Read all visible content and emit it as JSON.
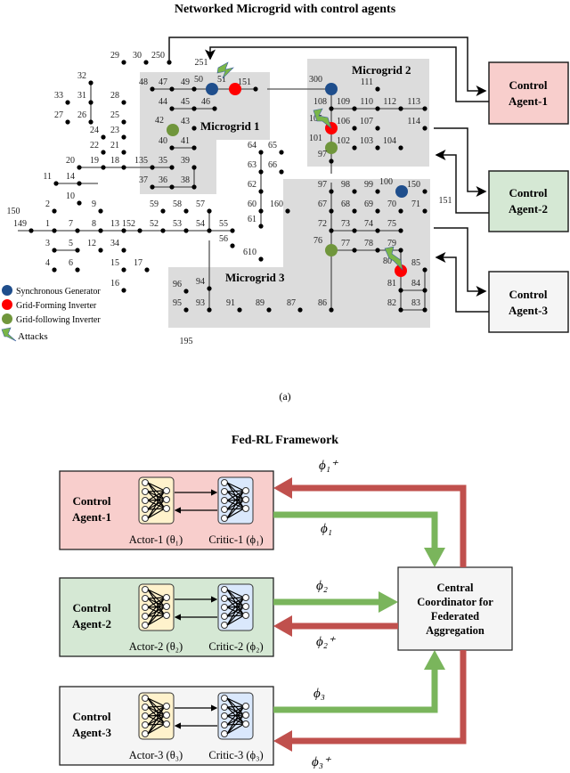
{
  "top_title": "Networked Microgrid with control agents",
  "caption": "(a)",
  "microgrids": [
    "Microgrid 1",
    "Microgrid 2",
    "Microgrid 3"
  ],
  "agents_top": [
    "Control Agent-1",
    "Control Agent-2",
    "Control Agent-3"
  ],
  "legend": [
    {
      "label": "Synchronous Generator",
      "color": "#1f4e8c"
    },
    {
      "label": "Grid-Forming Inverter",
      "color": "#ff0000"
    },
    {
      "label": "Grid-following Inverter",
      "color": "#70963c"
    },
    {
      "label": "Attacks",
      "color": "#7ab648"
    }
  ],
  "nodes": [
    "29",
    "30",
    "250",
    "251",
    "48",
    "47",
    "49",
    "50",
    "51",
    "151",
    "44",
    "45",
    "46",
    "42",
    "43",
    "40",
    "41",
    "135",
    "35",
    "39",
    "37",
    "36",
    "38",
    "32",
    "33",
    "31",
    "28",
    "27",
    "26",
    "25",
    "24",
    "23",
    "22",
    "21",
    "20",
    "19",
    "18",
    "11",
    "14",
    "10",
    "2",
    "9",
    "64",
    "63",
    "62",
    "60",
    "65",
    "66",
    "160",
    "150",
    "149",
    "1",
    "7",
    "8",
    "13",
    "152",
    "52",
    "53",
    "54",
    "55",
    "59",
    "58",
    "57",
    "3",
    "5",
    "12",
    "34",
    "4",
    "6",
    "15",
    "17",
    "16",
    "56",
    "61",
    "610",
    "96",
    "94",
    "95",
    "93",
    "91",
    "89",
    "87",
    "86",
    "195",
    "97",
    "98",
    "99",
    "100",
    "150b",
    "67",
    "68",
    "69",
    "70",
    "71",
    "72",
    "73",
    "74",
    "75",
    "76",
    "77",
    "78",
    "79",
    "80",
    "85",
    "81",
    "84",
    "82",
    "83",
    "151b",
    "300",
    "111",
    "108",
    "109",
    "110",
    "112",
    "113",
    "105",
    "106",
    "107",
    "114",
    "101",
    "102",
    "103",
    "104",
    "97b"
  ],
  "node_labels": {
    "150b": "150",
    "151b": "151",
    "97b": "97"
  },
  "node_colors": {
    "50": "#1f4e8c",
    "300": "#1f4e8c",
    "100": "#1f4e8c",
    "51": "#ff0000",
    "105": "#ff0000",
    "80": "#ff0000",
    "42": "#70963c",
    "101": "#70963c",
    "76": "#70963c"
  },
  "fed": {
    "title": "Fed-RL Framework",
    "agents": [
      {
        "name": "Control Agent-1",
        "actor": "Actor-1 (θ₁)",
        "critic": "Critic-1 (ϕ₁)",
        "fill": "#f8cecc"
      },
      {
        "name": "Control Agent-2",
        "actor": "Actor-2 (θ₂)",
        "critic": "Critic-2 (ϕ₂)",
        "fill": "#d5e8d4"
      },
      {
        "name": "Control Agent-3",
        "actor": "Actor-3 (θ₃)",
        "critic": "Critic-3 (ϕ₃)",
        "fill": "#f5f5f5"
      }
    ],
    "coordinator": [
      "Central",
      "Coordinator for",
      "Federated",
      "Aggregation"
    ],
    "params": {
      "p1plus": "ϕ₁⁺",
      "p1": "ϕ₁",
      "p2": "ϕ₂",
      "p2plus": "ϕ₂⁺",
      "p3": "ϕ₃",
      "p3plus": "ϕ₃⁺"
    },
    "colors": {
      "upload": "#7ab55c",
      "download": "#c0504d"
    }
  }
}
